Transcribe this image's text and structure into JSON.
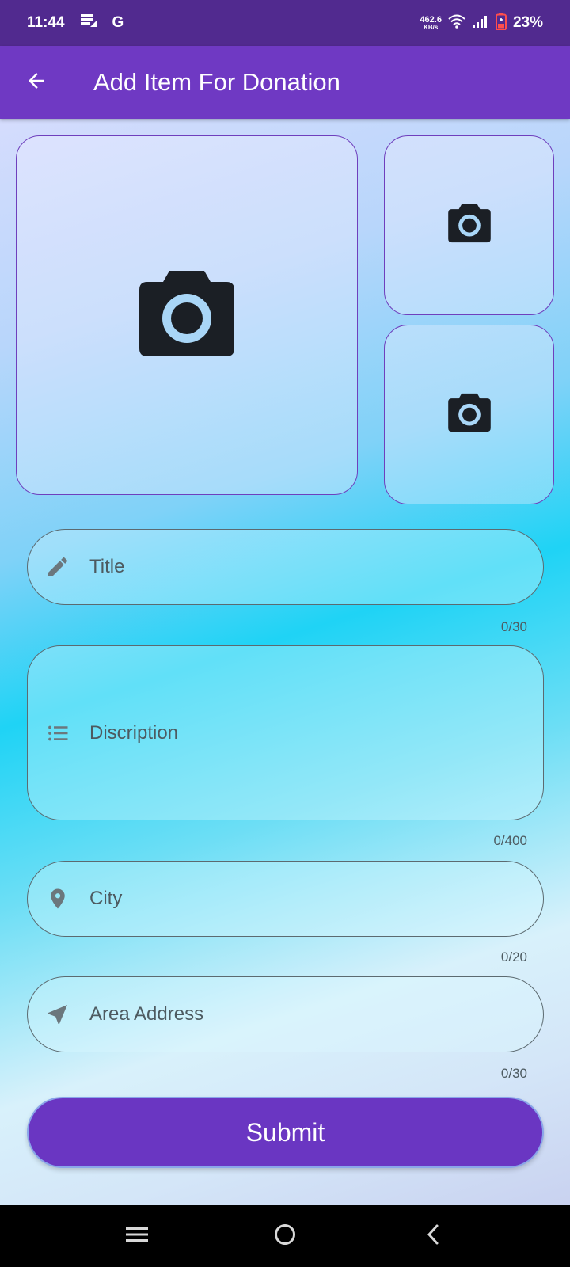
{
  "status_bar": {
    "time": "11:44",
    "carrier_letter": "G",
    "net_speed_value": "462.6",
    "net_speed_unit": "KB/s",
    "battery": "23%",
    "icons": [
      "data-saver-icon",
      "wifi-icon",
      "signal-icon",
      "battery-icon"
    ]
  },
  "app_bar": {
    "title": "Add Item For Donation",
    "back_icon": "arrow-back-icon"
  },
  "photos": {
    "icon": "camera-icon",
    "slots": [
      "main-photo",
      "photo-2",
      "photo-3"
    ]
  },
  "form": {
    "title": {
      "placeholder": "Title",
      "counter": "0/30",
      "icon": "pencil-icon"
    },
    "description": {
      "placeholder": "Discription",
      "counter": "0/400",
      "icon": "list-icon"
    },
    "city": {
      "placeholder": "City",
      "counter": "0/20",
      "icon": "location-pin-icon"
    },
    "area": {
      "placeholder": "Area Address",
      "counter": "0/30",
      "icon": "navigation-arrow-icon"
    }
  },
  "submit": {
    "label": "Submit"
  },
  "colors": {
    "status_bar": "#512a8f",
    "app_bar": "#6f39c3",
    "accent": "#6a36c2",
    "field_border": "#5c6a70",
    "field_text": "#4d5a60"
  },
  "nav_bar": {
    "icons": [
      "menu-icon",
      "home-icon",
      "back-nav-icon"
    ]
  }
}
